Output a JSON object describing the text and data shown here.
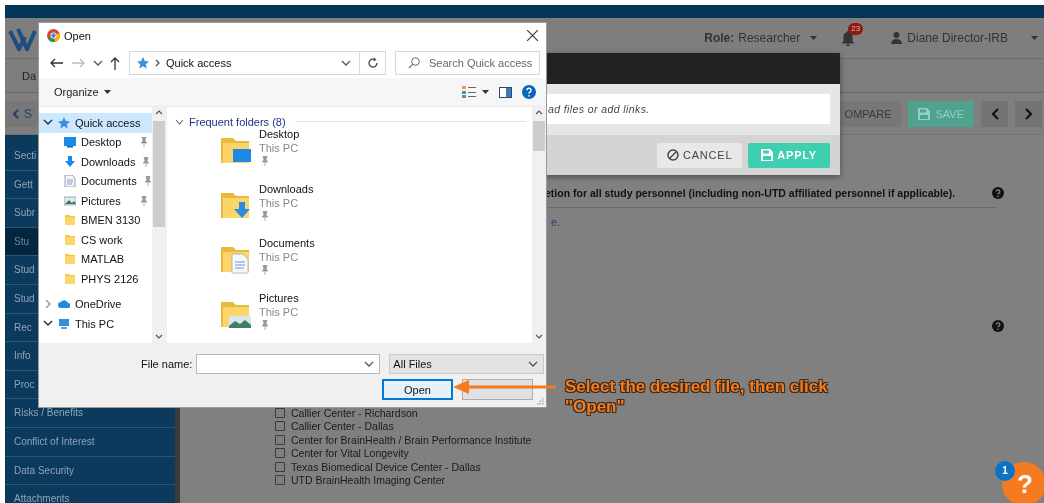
{
  "app": {
    "role_label": "Role:",
    "role": "Researcher",
    "notification_count": "23",
    "user": "Diane Director-IRB",
    "tab": "Da",
    "back_button": "S",
    "toolbar_buttons": [
      {
        "label": "OMPARE",
        "kind": "plain"
      },
      {
        "label": "SAVE",
        "kind": "save"
      }
    ],
    "sidebar": {
      "items": [
        {
          "label": "Secti",
          "selected": false
        },
        {
          "label": "Gett",
          "selected": false
        },
        {
          "label": "Subr",
          "selected": false
        },
        {
          "label": "Stu",
          "selected": true
        },
        {
          "label": "Stud",
          "selected": false
        },
        {
          "label": "Stud",
          "selected": false
        },
        {
          "label": "Rec",
          "selected": false
        },
        {
          "label": "Info",
          "selected": false
        },
        {
          "label": "Proc",
          "selected": false
        },
        {
          "label": "Risks / Benefits",
          "selected": false
        },
        {
          "label": "Conflict of Interest",
          "selected": false
        },
        {
          "label": "Data Security",
          "selected": false
        },
        {
          "label": "Attachments",
          "selected": false
        }
      ]
    },
    "content": {
      "question": "etion for all study personnel (including non-UTD affiliated personnel if applicable).",
      "link": "e.",
      "checkboxes": [
        {
          "label": "Callier Center - Richardson",
          "checked": false
        },
        {
          "label": "Callier Center - Dallas",
          "checked": false
        },
        {
          "label": "Center for BrainHealth / Brain Performance Institute",
          "checked": false
        },
        {
          "label": "Center for Vital Longevity",
          "checked": false
        },
        {
          "label": "Texas Biomedical Device Center - Dallas",
          "checked": false
        },
        {
          "label": "UTD BrainHealth Imaging Center",
          "checked": false
        }
      ]
    }
  },
  "modal": {
    "field_text": "ad files or add links.",
    "buttons": [
      {
        "label": "CANCEL",
        "kind": "cancel"
      },
      {
        "label": "APPLY",
        "kind": "apply"
      }
    ]
  },
  "file_dialog": {
    "title": "Open",
    "address": "Quick access",
    "search_placeholder": "Search Quick access",
    "organize": "Organize",
    "nav_tree": [
      {
        "label": "Quick access",
        "kind": "star",
        "expanded": true,
        "selected": true,
        "children": [
          {
            "label": "Desktop",
            "kind": "desktop",
            "pinned": true
          },
          {
            "label": "Downloads",
            "kind": "downloads",
            "pinned": true
          },
          {
            "label": "Documents",
            "kind": "documents",
            "pinned": true
          },
          {
            "label": "Pictures",
            "kind": "pictures",
            "pinned": true
          },
          {
            "label": "BMEN 3130",
            "kind": "folder",
            "pinned": false
          },
          {
            "label": "CS work",
            "kind": "folder",
            "pinned": false
          },
          {
            "label": "MATLAB",
            "kind": "folder",
            "pinned": false
          },
          {
            "label": "PHYS 2126",
            "kind": "folder",
            "pinned": false
          }
        ]
      },
      {
        "label": "OneDrive",
        "kind": "cloud",
        "expanded": false,
        "selected": false
      },
      {
        "label": "This PC",
        "kind": "pc",
        "expanded": true,
        "selected": false
      }
    ],
    "group": {
      "label": "Frequent folders (8)",
      "expanded": true
    },
    "folders": [
      {
        "name": "Desktop",
        "location": "This PC",
        "kind": "desktop",
        "pinned": true
      },
      {
        "name": "Downloads",
        "location": "This PC",
        "kind": "downloads",
        "pinned": true
      },
      {
        "name": "Documents",
        "location": "This PC",
        "kind": "documents",
        "pinned": true
      },
      {
        "name": "Pictures",
        "location": "This PC",
        "kind": "pictures",
        "pinned": true
      }
    ],
    "file_name_label": "File name:",
    "filter": "All Files",
    "buttons": [
      {
        "label": "Open",
        "default": true
      },
      {
        "default": false
      }
    ]
  },
  "annotation": {
    "text": "Select the desired file, then click \"Open\""
  },
  "help_widget": {
    "label": "?",
    "badge": "1"
  }
}
